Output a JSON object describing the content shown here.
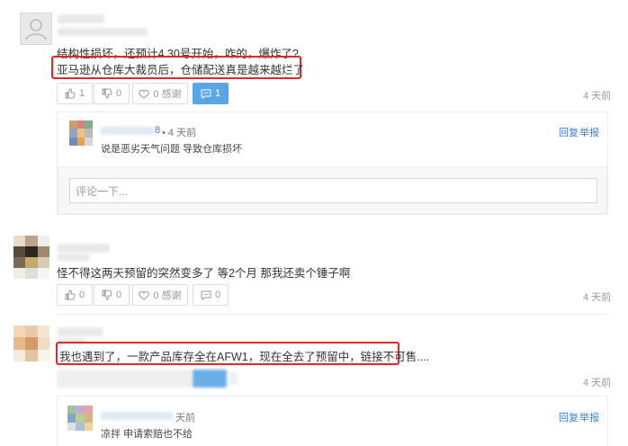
{
  "comments": [
    {
      "line1": "结构性损坏，还预计4.30号开始，咋的，爆炸了?",
      "line2": "亚马逊从仓库大裁员后，仓储配送真是越来越烂了",
      "likes": "1",
      "dislikes": "0",
      "thanks": "0 感谢",
      "replies": "1",
      "time": "4 天前"
    },
    {
      "line1": "怪不得这两天预留的突然变多了 等2个月 那我还卖个锤子啊",
      "likes": "0",
      "dislikes": "0",
      "thanks": "0 感谢",
      "replies": "0",
      "time": "4 天前"
    },
    {
      "line1": "我也遇到了，一款产品库存全在AFW1，现在全去了预留中，链接不可售....",
      "time": "4 天前"
    }
  ],
  "subreplies": [
    {
      "name_suffix": "8",
      "time": "• 4 天前",
      "text": "说是恶劣天气问题 导致仓库损坏",
      "reply_label": "回复",
      "report_label": "举报"
    },
    {
      "time": "天前",
      "text": "凉拌 申请索赔也不给",
      "reply_label": "回复",
      "report_label": "举报"
    }
  ],
  "reply_input": {
    "placeholder": "评论一下..."
  },
  "colors": {
    "accent": "#5aa5e6",
    "highlight_border": "#e3262a",
    "link": "#3a7fd0"
  },
  "icons": [
    "user-icon",
    "thumb-up-icon",
    "thumb-down-icon",
    "heart-icon",
    "comment-icon"
  ]
}
